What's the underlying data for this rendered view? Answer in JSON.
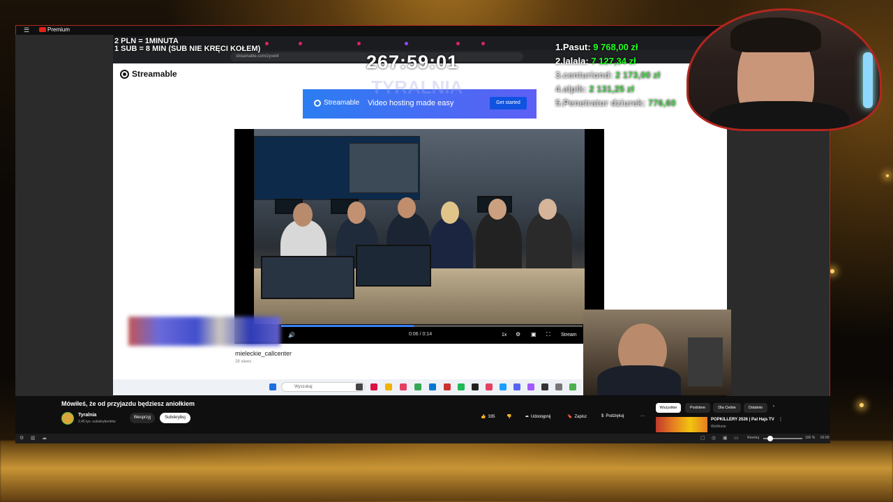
{
  "overlay": {
    "donate_rate_line1": "2 PLN = 1MINUTA",
    "donate_rate_line2": "1 SUB = 8 MIN (SUB NIE KRĘCI KOŁEM)",
    "timer": "267:59:01",
    "watermark": "TYRALNIA",
    "leaderboard": [
      {
        "name": "1.Pasut:",
        "amount": "9 768,00 zł"
      },
      {
        "name": "2.lalala:",
        "amount": "7 127,34 zł"
      },
      {
        "name": "3.centuriond:",
        "amount": "2 173,00 zł"
      },
      {
        "name": "4.alpik:",
        "amount": "2 131,25 zł"
      },
      {
        "name": "5.Penetrator dziurek:",
        "amount": "776,60"
      }
    ]
  },
  "youtube": {
    "logo": "Premium",
    "video_title": "Mówiłeś, że od przyjazdu będziesz aniołkiem",
    "channel_name": "Tyralnia",
    "channel_subs": "2,45 tys. subskrybentów",
    "support_label": "Wesprzyj",
    "subscribe_label": "Subskrybuj",
    "like_count": "335",
    "share_label": "Udostępnij",
    "save_label": "Zapisz",
    "thanks_label": "Podziękuj",
    "more_label": "···",
    "chips": [
      "Wszystkie",
      "Podobne",
      "Dla Ciebie",
      "Ostatnio"
    ],
    "recommended_title": "POPKILLERY 2026 | Pal Hajs TV",
    "recommended_channel": "WuWunio",
    "zoom_reset": "Resetuj",
    "zoom_pct": "100 %",
    "time_right": "02:00"
  },
  "browser": {
    "url": "streamable.com/zyvet4"
  },
  "streamable": {
    "logo": "Streamable",
    "banner_logo": "Streamable",
    "banner_text": "Video hosting made easy",
    "banner_button": "Get started",
    "player_time": "0:06 / 0:14",
    "speed": "1x",
    "player_brand": "Stream",
    "video_name": "mieleckie_callcenter",
    "video_views": "28 views"
  },
  "taskbar": {
    "search_placeholder": "Wyszukaj"
  },
  "colors": {
    "frame_red": "#b3261e",
    "leader_green": "#22ff22",
    "banner_blue": "#2b7df2",
    "progress_blue": "#3b82f6"
  },
  "progress": {
    "played_fraction": 0.44
  }
}
